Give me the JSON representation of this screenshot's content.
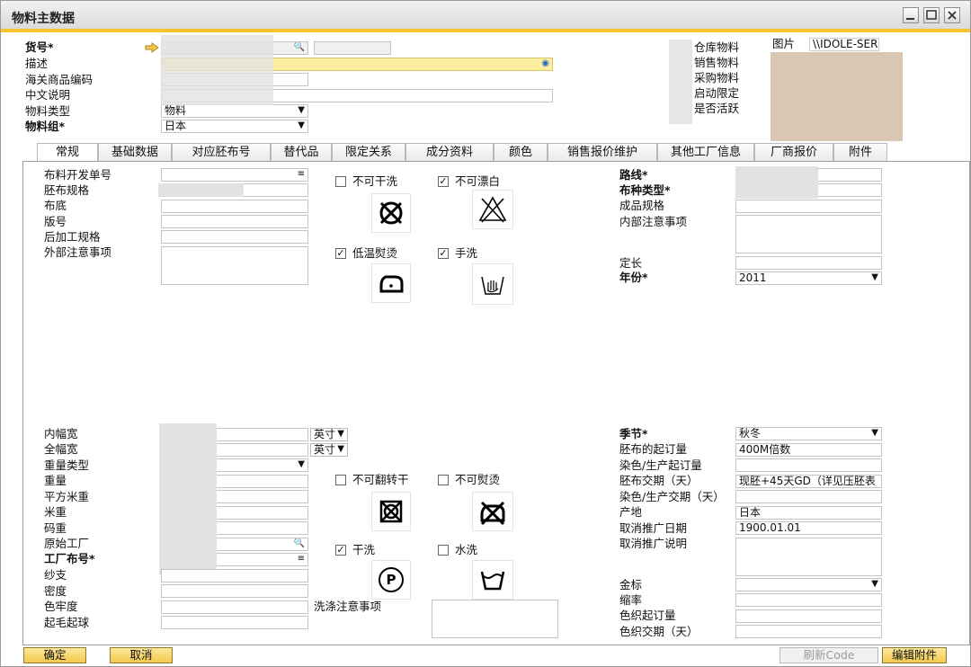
{
  "window": {
    "title": "物料主数据"
  },
  "header": {
    "item_code": {
      "label": "货号*"
    },
    "description": {
      "label": "描述"
    },
    "customs_code": {
      "label": "海关商品编码"
    },
    "chinese_desc": {
      "label": "中文说明"
    },
    "item_type": {
      "label": "物料类型",
      "value": "物料"
    },
    "item_group": {
      "label": "物料组*",
      "value": "日本"
    },
    "flags": [
      "仓库物料",
      "销售物料",
      "采购物料",
      "启动限定",
      "是否活跃"
    ],
    "picture": {
      "label": "图片",
      "path": "\\\\IDOLE-SER"
    }
  },
  "tabs": [
    "常规",
    "基础数据",
    "对应胚布号",
    "替代品",
    "限定关系",
    "成分资料",
    "颜色",
    "销售报价维护",
    "其他工厂信息",
    "厂商报价",
    "附件"
  ],
  "general": {
    "left_top": [
      "布料开发单号",
      "胚布规格",
      "布底",
      "版号",
      "后加工规格",
      "外部注意事项"
    ],
    "care": [
      {
        "label": "不可干洗",
        "checked": false,
        "icon": "no-dry-clean-icon"
      },
      {
        "label": "不可漂白",
        "checked": true,
        "icon": "no-bleach-icon"
      },
      {
        "label": "低温熨烫",
        "checked": true,
        "icon": "iron-low-icon"
      },
      {
        "label": "手洗",
        "checked": true,
        "icon": "hand-wash-icon"
      },
      {
        "label": "不可翻转干",
        "checked": false,
        "icon": "no-tumble-dry-icon"
      },
      {
        "label": "不可熨烫",
        "checked": false,
        "icon": "no-iron-icon"
      },
      {
        "label": "干洗",
        "checked": true,
        "icon": "dry-clean-p-icon"
      },
      {
        "label": "水洗",
        "checked": false,
        "icon": "wash-tub-icon"
      }
    ],
    "right_top": {
      "route": {
        "label": "路线*"
      },
      "fabric_type": {
        "label": "布种类型*"
      },
      "finished_spec": {
        "label": "成品规格"
      },
      "internal_notes": {
        "label": "内部注意事项"
      },
      "fixed_length": {
        "label": "定长"
      },
      "year": {
        "label": "年份*",
        "value": "2011"
      }
    },
    "left_bottom": {
      "inner_width": {
        "label": "内幅宽",
        "unit": "英寸"
      },
      "full_width": {
        "label": "全幅宽",
        "unit": "英寸"
      },
      "others": [
        "重量类型",
        "重量",
        "平方米重",
        "米重",
        "码重",
        "原始工厂",
        "工厂布号*",
        "纱支",
        "密度",
        "色牢度",
        "起毛起球"
      ]
    },
    "wash_notes": {
      "label": "洗涤注意事项"
    },
    "right_bottom": [
      {
        "label": "季节*",
        "value": "秋冬"
      },
      {
        "label": "胚布的起订量",
        "value": "400M倍数"
      },
      {
        "label": "染色/生产起订量",
        "value": ""
      },
      {
        "label": "胚布交期（天）",
        "value": "现胚+45天GD（详见压胚表"
      },
      {
        "label": "染色/生产交期（天）",
        "value": ""
      },
      {
        "label": "产地",
        "value": "日本"
      },
      {
        "label": "取消推广日期",
        "value": "1900.01.01"
      },
      {
        "label": "取消推广说明",
        "value": ""
      }
    ],
    "right_last": [
      "金标",
      "缩率",
      "色织起订量",
      "色织交期（天）"
    ]
  },
  "buttons": {
    "ok": "确定",
    "cancel": "取消",
    "refresh": "刷新Code",
    "edit_attach": "编辑附件"
  }
}
